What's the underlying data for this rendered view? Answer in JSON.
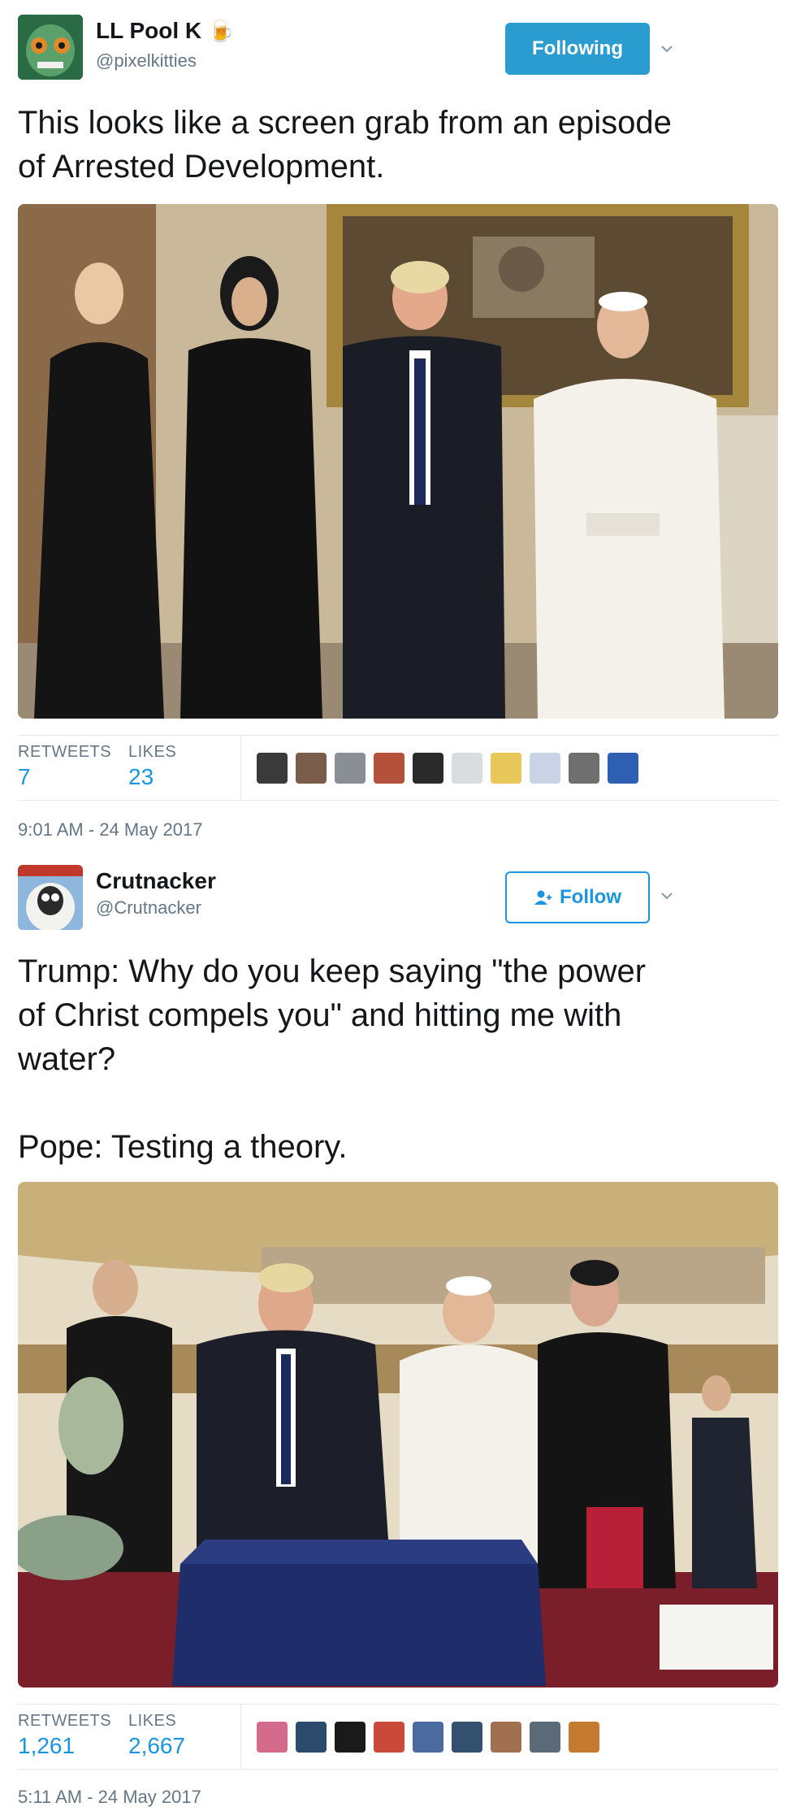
{
  "tweets": [
    {
      "display_name": "LL Pool K",
      "name_emoji": "🍺",
      "handle": "@pixelkitties",
      "follow_label": "Following",
      "text_lines": [
        "This looks like a screen grab from an episode",
        "of Arrested Development."
      ],
      "retweets_label": "RETWEETS",
      "retweets": "7",
      "likes_label": "LIKES",
      "likes": "23",
      "timestamp": "9:01 AM - 24 May 2017",
      "liker_colors": [
        "#3a3a3a",
        "#7a5c4a",
        "#8a8f96",
        "#b4513a",
        "#2a2a2a",
        "#d9dde0",
        "#e8c75a",
        "#c9d3e6",
        "#6f6f6f",
        "#2f5fb3"
      ]
    },
    {
      "display_name": "Crutnacker",
      "handle": "@Crutnacker",
      "follow_label": "Follow",
      "text_lines": [
        "Trump: Why do you keep saying \"the power",
        "of Christ compels you\" and hitting me with",
        "water?",
        "",
        "Pope: Testing a theory."
      ],
      "retweets_label": "RETWEETS",
      "retweets": "1,261",
      "likes_label": "LIKES",
      "likes": "2,667",
      "timestamp": "5:11 AM - 24 May 2017",
      "liker_colors": [
        "#d46a8c",
        "#2c4a6b",
        "#1a1a1a",
        "#c94a3a",
        "#4a6aa0",
        "#33506e",
        "#a07050",
        "#5a6a78",
        "#c47a30"
      ]
    }
  ],
  "colors": {
    "accent": "#1b95e0",
    "following_bg": "#2b9ccf",
    "muted": "#657786",
    "border": "#e1e8ed"
  },
  "icons": {
    "chevron": "chevron-down-icon",
    "follow_person": "person-plus-icon"
  }
}
